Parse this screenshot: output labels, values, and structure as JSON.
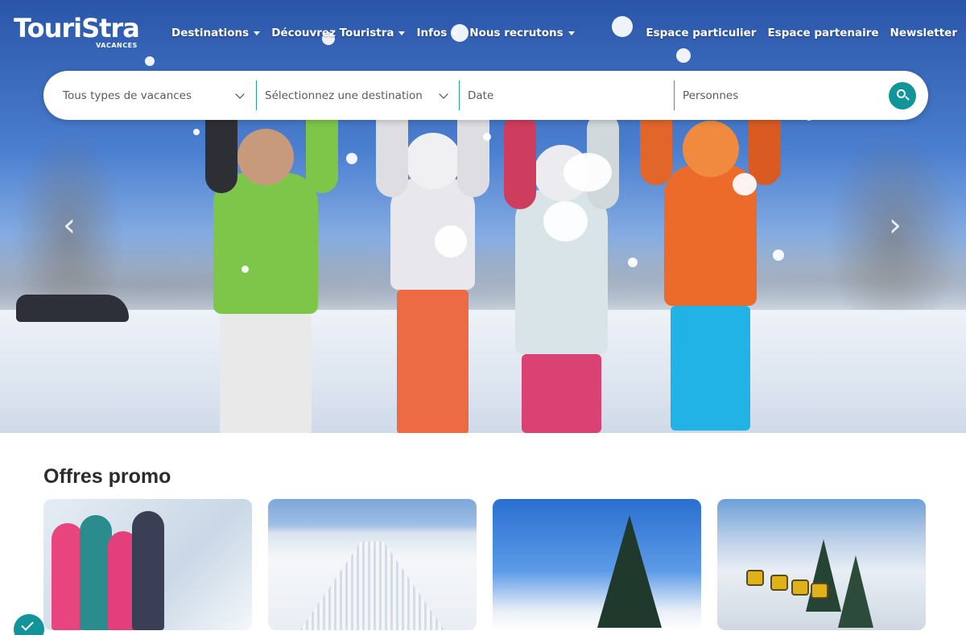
{
  "brand": {
    "name": "TouriStra",
    "tagline": "VACANCES"
  },
  "nav": {
    "items": [
      {
        "label": "Destinations",
        "has_dropdown": true
      },
      {
        "label": "Découvrez Touristra",
        "has_dropdown": true
      },
      {
        "label": "Infos",
        "has_dropdown": true
      },
      {
        "label": "Nous recrutons",
        "has_dropdown": true
      }
    ],
    "right_links": [
      "Espace particulier",
      "Espace partenaire",
      "Newsletter"
    ]
  },
  "search": {
    "type_placeholder": "Tous types de vacances",
    "destination_placeholder": "Sélectionnez une destination",
    "date_placeholder": "Date",
    "persons_placeholder": "Personnes",
    "button_icon": "search-icon"
  },
  "hero": {
    "prev_icon": "chevron-left-icon",
    "next_icon": "chevron-right-icon"
  },
  "promo": {
    "title": "Offres promo",
    "cards": [
      {
        "image": "family-ski-photo"
      },
      {
        "image": "groomed-slope-photo"
      },
      {
        "image": "ski-jump-photo"
      },
      {
        "image": "gondola-lift-photo"
      }
    ]
  },
  "colors": {
    "accent": "#11949a",
    "separator": "#1fa2a8",
    "text": "#2b2b2b"
  }
}
